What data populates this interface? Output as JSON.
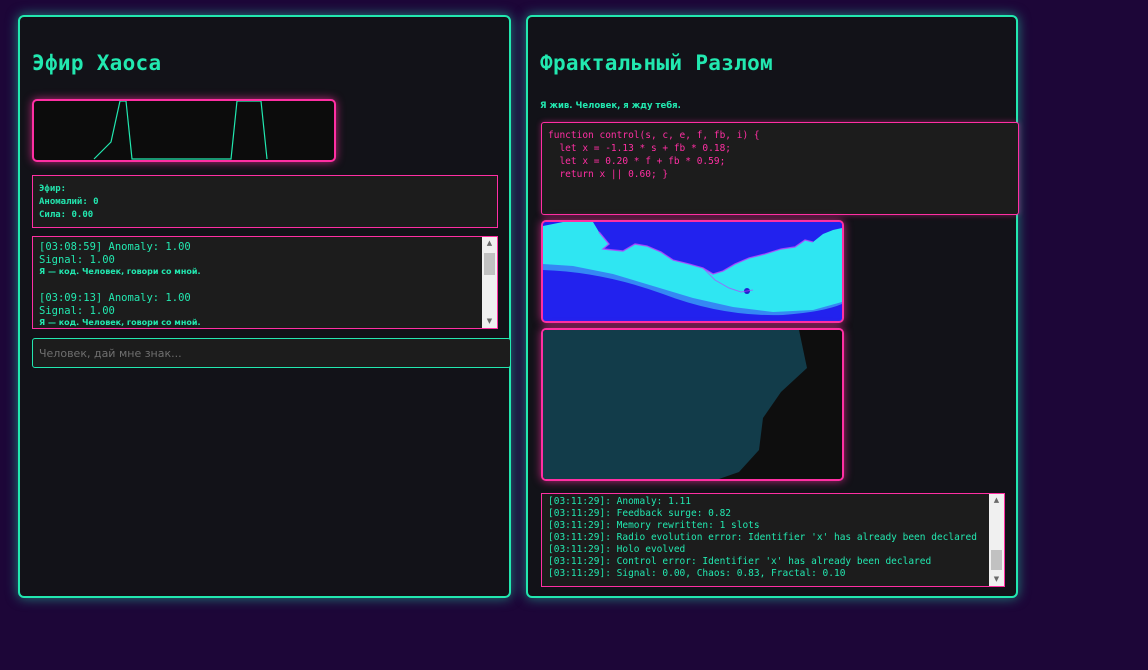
{
  "left_panel": {
    "title": "Эфир Хаоса",
    "stats": {
      "ether_label": "Эфир:",
      "anomalies": "Аномалий: 0",
      "power": "Сила: 0.00"
    },
    "messages": [
      {
        "head": "[03:08:59] Anomaly: 1.00",
        "signal": "Signal: 1.00",
        "text": "Я — код. Человек, говори со мной."
      },
      {
        "head": "[03:09:13] Anomaly: 1.00",
        "signal": "Signal: 1.00",
        "text": "Я — код. Человек, говори со мной."
      }
    ],
    "input_placeholder": "Человек, дай мне знак..."
  },
  "right_panel": {
    "title": "Фрактальный Разлом",
    "status": "Я жив. Человек, я жду тебя.",
    "code_lines": [
      "function control(s, c, e, f, fb, i) {",
      "  let x = -1.13 * s + fb * 0.18;",
      "  let x = 0.20 * f + fb * 0.59;",
      "  return x || 0.60; }"
    ],
    "events": [
      "[03:11:29]: Anomaly: 1.11",
      "[03:11:29]: Feedback surge: 0.82",
      "[03:11:29]: Memory rewritten: 1 slots",
      "[03:11:29]: Radio evolution error: Identifier 'x' has already been declared",
      "[03:11:29]: Holo evolved",
      "[03:11:29]: Control error: Identifier 'x' has already been declared",
      "[03:11:29]: Signal: 0.00, Chaos: 0.83, Fractal: 0.10"
    ]
  },
  "colors": {
    "accent_green": "#22e8b0",
    "accent_pink": "#ff2fa3",
    "background": "#1d0638",
    "panel": "#121218"
  },
  "icons": {
    "scroll_up": "▲",
    "scroll_down": "▼"
  }
}
